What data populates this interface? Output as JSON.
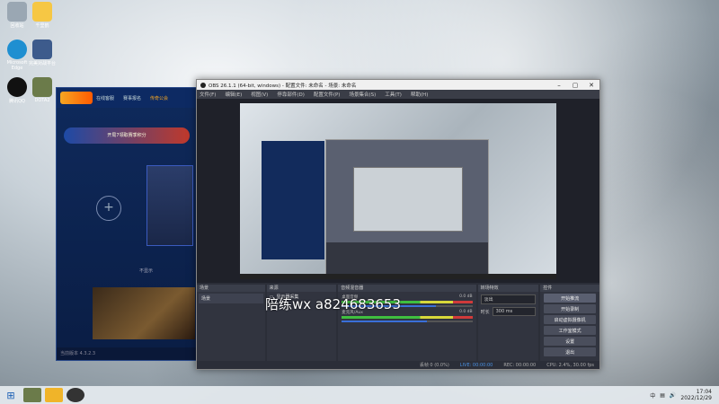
{
  "desktop_icons": [
    {
      "label": "回收站",
      "color": "#9aa7b3"
    },
    {
      "label": "千里鹤",
      "color": "#f6c744"
    },
    {
      "label": "Microsoft Edge",
      "color": "#1f8fd1"
    },
    {
      "label": "完美对战平台",
      "color": "#3d5b8c"
    },
    {
      "label": "腾讯QQ",
      "color": "#111111"
    },
    {
      "label": "DOTA2",
      "color": "#6b7b4a"
    }
  ],
  "launcher": {
    "tabs": [
      "在线客服",
      "赛事报名",
      "传奇公会"
    ],
    "banner": "开局7领取赛季积分",
    "plus": "+",
    "footer": "当前版本 4.3.2.3",
    "toggle": "不显示"
  },
  "obs": {
    "title": "OBS 26.1.1 (64-bit, windows) - 配置文件: 未命名 - 场景: 未命名",
    "menus": [
      "文件(F)",
      "编辑(E)",
      "视图(V)",
      "停靠部件(D)",
      "配置文件(P)",
      "场景集合(S)",
      "工具(T)",
      "帮助(H)"
    ],
    "window_controls": [
      "–",
      "▢",
      "✕"
    ],
    "panels": {
      "scenes": {
        "header": "场景",
        "items": [
          "场景"
        ]
      },
      "sources": {
        "header": "来源",
        "items": [
          "显示器采集"
        ]
      },
      "mixer": {
        "header": "音频混音器",
        "rows": [
          {
            "name": "桌面音频",
            "db": "0.0 dB",
            "level": 0.72
          },
          {
            "name": "麦克风/Aux",
            "db": "0.0 dB",
            "level": 0.65
          }
        ]
      },
      "transitions": {
        "header": "转场特效",
        "type": "淡出",
        "duration_label": "时长",
        "duration": "300 ms"
      },
      "controls": {
        "header": "控件",
        "buttons": [
          "开始推流",
          "开始录制",
          "启动虚拟摄像机",
          "工作室模式",
          "设置",
          "退出"
        ]
      }
    },
    "preview_label": "未选择来源",
    "status": {
      "live": "LIVE: 00:00:00",
      "rec": "REC: 00:00:00",
      "cpu": "CPU: 2.4%, 30.00 fps",
      "dropped": "丢帧 0 (0.0%)"
    }
  },
  "watermark": "陪练wx  a824683653",
  "taskbar": {
    "time": "17:04",
    "date": "2022/12/29",
    "ime": "中",
    "apps": [
      {
        "name": "dota",
        "color": "#6b7b4a"
      },
      {
        "name": "folder",
        "color": "#f0b429"
      },
      {
        "name": "obs",
        "color": "#333333"
      }
    ]
  }
}
